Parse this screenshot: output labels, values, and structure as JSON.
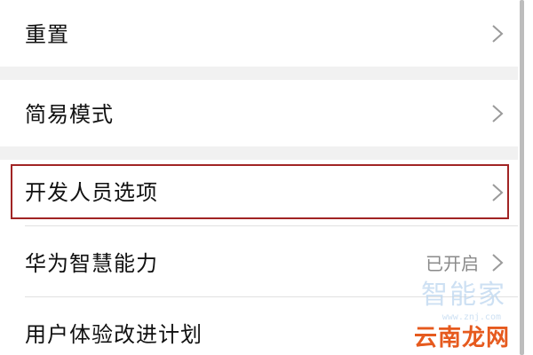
{
  "settings": {
    "items": [
      {
        "label": "重置"
      },
      {
        "label": "简易模式"
      },
      {
        "label": "开发人员选项"
      },
      {
        "label": "华为智慧能力",
        "status": "已开启"
      },
      {
        "label": "用户体验改进计划"
      }
    ]
  },
  "watermark": {
    "top_text": "智能家",
    "sub_text": "www.znj.com",
    "main_text": "云南龙网"
  },
  "colors": {
    "background": "#ffffff",
    "section_gap": "#f1f1f1",
    "highlight_border": "#a12424",
    "status_text": "#8a8a8a",
    "watermark_main": "#e65a1e",
    "watermark_faint": "#b9d4ee"
  }
}
